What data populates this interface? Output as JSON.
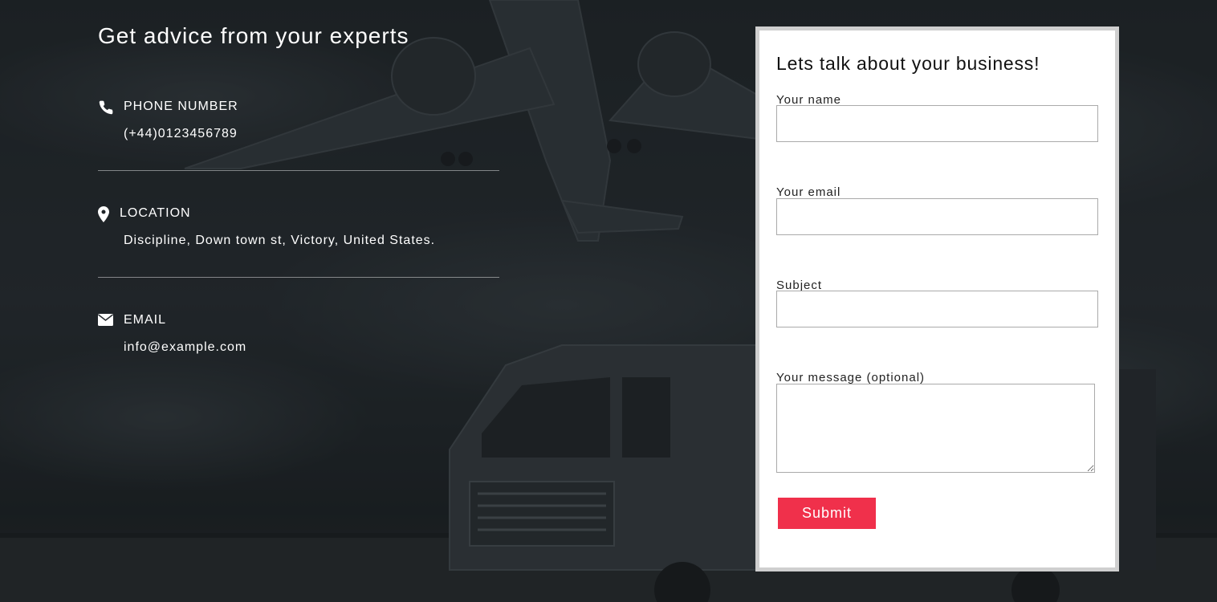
{
  "headline": "Get advice from your experts",
  "contact": {
    "phone": {
      "title": "PHONE NUMBER",
      "value": "(+44)0123456789",
      "icon": "phone-icon"
    },
    "location": {
      "title": "LOCATION",
      "value": "Discipline, Down town st, Victory, United States.",
      "icon": "map-pin-icon"
    },
    "email": {
      "title": "EMAIL",
      "value": "info@example.com",
      "icon": "envelope-icon"
    }
  },
  "form": {
    "title": "Lets talk about your business!",
    "name_label": "Your name",
    "email_label": "Your email",
    "subject_label": "Subject",
    "message_label": "Your message (optional)",
    "name_value": "",
    "email_value": "",
    "subject_value": "",
    "message_value": "",
    "submit_label": "Submit"
  },
  "colors": {
    "accent": "#f0304b",
    "overlay": "#1c2023",
    "text_light": "#ffffff"
  }
}
